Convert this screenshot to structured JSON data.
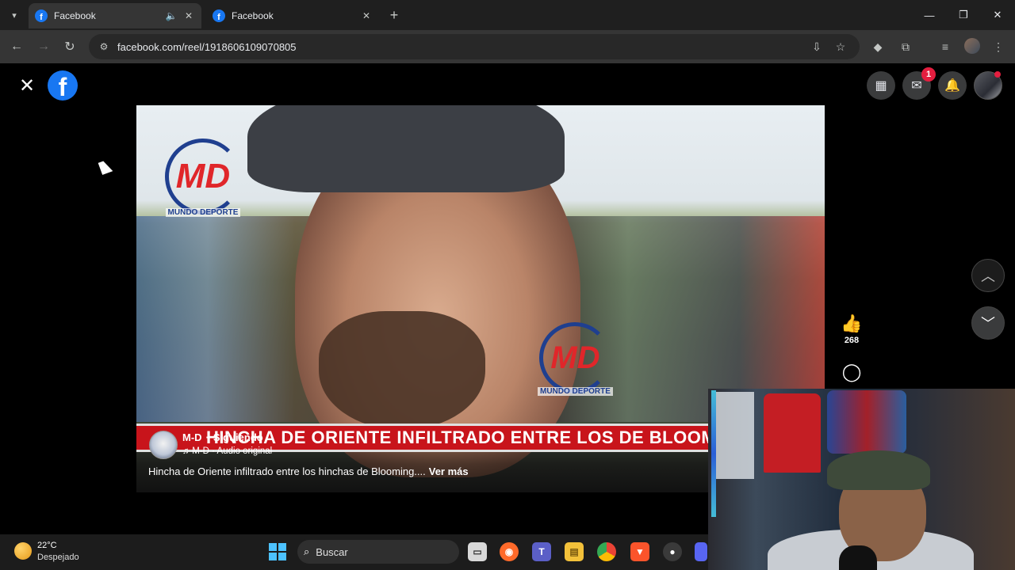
{
  "browser": {
    "tabs": [
      {
        "title": "Facebook",
        "active": true,
        "has_audio": true
      },
      {
        "title": "Facebook",
        "active": false,
        "has_audio": false
      }
    ],
    "url": "facebook.com/reel/1918606109070805"
  },
  "facebook": {
    "notification_count": "1"
  },
  "reel": {
    "banner_text": "HINCHA DE ORIENTE INFILTRADO ENTRE LOS DE BLOOMING",
    "watermark_brand": "MUNDO DEPORTE",
    "watermark_initials": "MD",
    "author": "M-D",
    "following_label": "Siguiendo",
    "audio_label": "M-D · Audio original",
    "caption": "Hincha de Oriente infiltrado entre los hinchas de Blooming....",
    "see_more": "Ver más",
    "like_count": "268"
  },
  "taskbar": {
    "temperature": "22°C",
    "condition": "Despejado",
    "search_placeholder": "Buscar"
  },
  "colors": {
    "facebook_blue": "#1877f2",
    "badge_red": "#e41e3f",
    "banner_red": "#c8141b",
    "windows_accent": "#4cc2ff"
  },
  "icons": {
    "tab_audio": "speaker-icon",
    "reel_like": "thumbs-up-icon",
    "reel_comment": "comment-icon",
    "nav_prev": "chevron-up-icon",
    "nav_next": "chevron-down-icon"
  }
}
